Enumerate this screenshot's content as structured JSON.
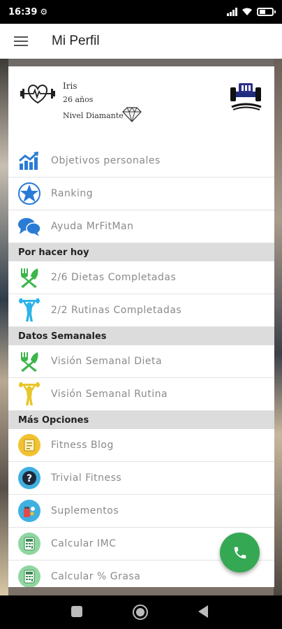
{
  "status_bar": {
    "time": "16:39",
    "icons": [
      "gear-icon",
      "signal-icon",
      "wifi-icon",
      "battery-icon"
    ]
  },
  "app_bar": {
    "title": "Mi Perfil",
    "menu_icon": "hamburger-menu-icon"
  },
  "profile": {
    "name": "Iris",
    "age": "26 años",
    "level": "Nivel Diamante",
    "avatar_icon": "heart-dumbbell-icon",
    "level_icon": "diamond-icon",
    "brand_logo": "mrfitman-coaching-logo"
  },
  "menu_top": [
    {
      "label": "Objetivos personales",
      "icon": "chart-growth-icon"
    },
    {
      "label": "Ranking",
      "icon": "star-icon"
    },
    {
      "label": "Ayuda MrFitMan",
      "icon": "chat-bubbles-icon"
    }
  ],
  "section_today": {
    "title": "Por hacer hoy",
    "items": [
      {
        "label": "2/6 Dietas Completadas",
        "icon": "fork-knife-icon"
      },
      {
        "label": "2/2 Rutinas Completadas",
        "icon": "person-lifting-icon"
      }
    ]
  },
  "section_weekly": {
    "title": "Datos Semanales",
    "items": [
      {
        "label": "Visión Semanal Dieta",
        "icon": "fork-knife-icon"
      },
      {
        "label": "Visión Semanal Rutina",
        "icon": "person-lifting-icon"
      }
    ]
  },
  "section_more": {
    "title": "Más Opciones",
    "items": [
      {
        "label": "Fitness Blog",
        "icon": "blog-icon"
      },
      {
        "label": "Trivial Fitness",
        "icon": "question-icon"
      },
      {
        "label": "Suplementos",
        "icon": "supplements-icon"
      },
      {
        "label": "Calcular IMC",
        "icon": "calculator-icon"
      },
      {
        "label": "Calcular % Grasa",
        "icon": "calculator-icon"
      }
    ]
  },
  "fab": {
    "icon": "phone-icon"
  },
  "nav_bar": {
    "icons": [
      "recents-icon",
      "home-icon",
      "back-icon"
    ]
  },
  "colors": {
    "accent_green": "#35a853",
    "blue": "#2a7bd6",
    "cyan": "#2bb3e8",
    "yellow": "#e8c62a",
    "section_bg": "#dcdcdc"
  }
}
